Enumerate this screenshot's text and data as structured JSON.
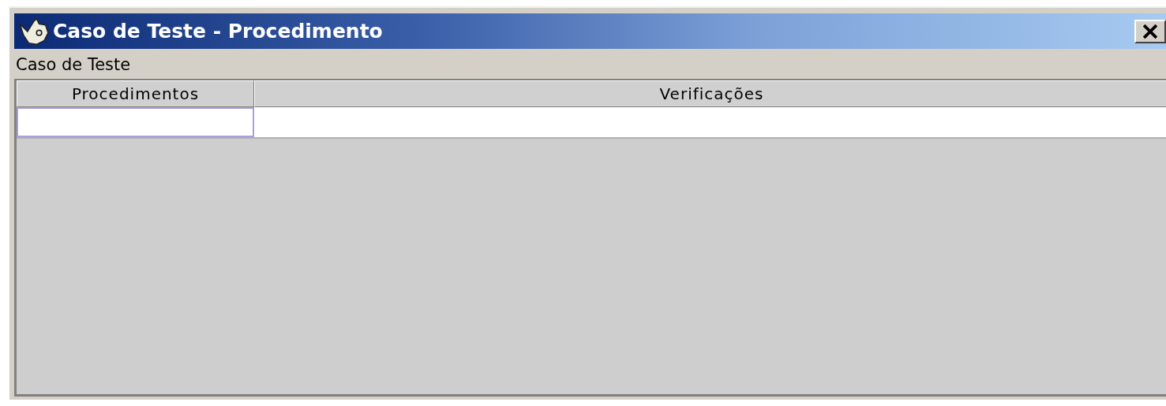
{
  "window": {
    "title": "Caso de Teste - Procedimento"
  },
  "section_label": "Caso de Teste",
  "table": {
    "columns": [
      "Procedimentos",
      "Verificações"
    ],
    "rows": [
      {
        "cells": [
          {
            "selected": true
          },
          {
            "selected": false
          }
        ]
      }
    ]
  }
}
